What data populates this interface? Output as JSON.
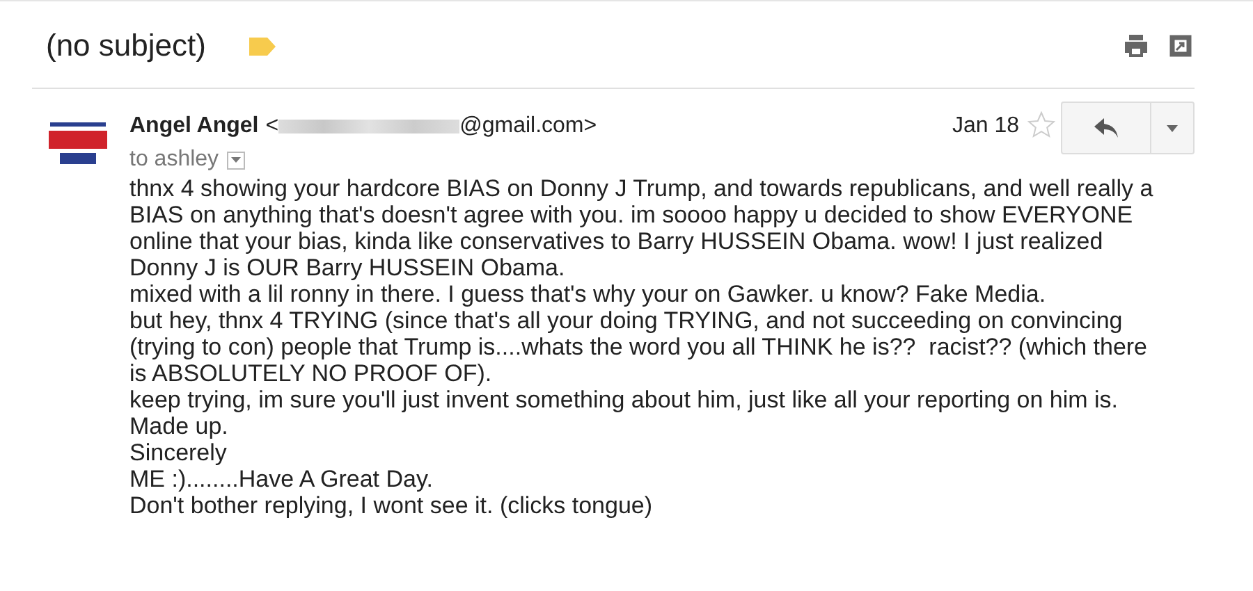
{
  "subject": {
    "title": "(no subject)"
  },
  "message": {
    "sender_name": "Angel Angel",
    "address_start": "<",
    "address_end": "@gmail.com>",
    "recipient": "to ashley",
    "date": "Jan 18",
    "starred": false,
    "body": [
      "thnx 4 showing your hardcore BIAS on Donny J Trump, and towards republicans, and well really a BIAS on anything that's doesn't agree with you. im soooo happy u decided to show EVERYONE online that your bias, kinda like conservatives to Barry HUSSEIN Obama. wow! I just realized Donny J is OUR Barry HUSSEIN Obama.",
      "mixed with a lil ronny in there. I guess that's why your on Gawker. u know? Fake Media.",
      "but hey, thnx 4 TRYING (since that's all your doing TRYING, and not succeeding on convincing (trying to con) people that Trump is....whats the word you all THINK he is??  racist?? (which there is ABSOLUTELY NO PROOF OF).",
      "keep trying, im sure you'll just invent something about him, just like all your reporting on him is. Made up.",
      "Sincerely",
      "ME :)........Have A Great Day.",
      "Don't bother replying, I wont see it. (clicks tongue)"
    ]
  }
}
